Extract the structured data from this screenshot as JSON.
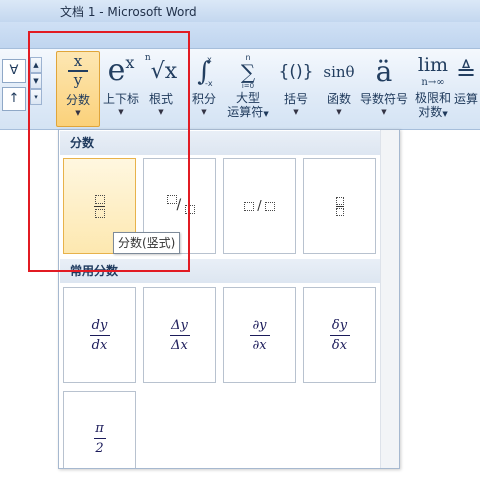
{
  "window": {
    "title": "文档 1 - Microsoft Word"
  },
  "ribbon": {
    "left_symbols": [
      "∀",
      "↑"
    ],
    "tools": [
      {
        "id": "fraction",
        "label": "分数",
        "icon": "fraction-icon"
      },
      {
        "id": "script",
        "label": "上下标",
        "icon": "superscript-icon"
      },
      {
        "id": "radical",
        "label": "根式",
        "icon": "radical-icon"
      },
      {
        "id": "integral",
        "label": "积分",
        "icon": "integral-icon"
      },
      {
        "id": "large-operator",
        "label": "大型",
        "label2": "运算符",
        "icon": "sum-icon"
      },
      {
        "id": "bracket",
        "label": "括号",
        "icon": "bracket-icon"
      },
      {
        "id": "function",
        "label": "函数",
        "icon": "sin-icon"
      },
      {
        "id": "accent",
        "label": "导数符号",
        "icon": "accent-icon"
      },
      {
        "id": "limit-log",
        "label": "极限和",
        "label2": "对数",
        "icon": "limit-icon"
      },
      {
        "id": "operator",
        "label": "运算",
        "icon": "operator-icon"
      }
    ],
    "icon_text": {
      "fraction_num": "x",
      "fraction_den": "y",
      "script_base": "e",
      "script_sup": "x",
      "radical_index": "n",
      "radical_body": "√x",
      "integral_sign": "∫",
      "integral_upper": "x",
      "integral_lower": "-x",
      "sum_upper": "n",
      "sum_sign": "∑",
      "sum_lower": "i=0",
      "bracket": "{()}",
      "function": "sinθ",
      "accent": "ä",
      "limit_text": "lim",
      "limit_sub": "n→∞",
      "operator": "≜"
    }
  },
  "dropdown": {
    "section1": "分数",
    "section2": "常用分数",
    "common": [
      {
        "num": "dy",
        "den": "dx"
      },
      {
        "num": "Δy",
        "den": "Δx"
      },
      {
        "num": "∂y",
        "den": "∂x"
      },
      {
        "num": "δy",
        "den": "δx"
      },
      {
        "num": "π",
        "den": "2"
      }
    ],
    "tooltip": "分数(竖式)"
  },
  "colors": {
    "highlight_box": "#e21b23",
    "selected_fill": "#fbd17a"
  }
}
